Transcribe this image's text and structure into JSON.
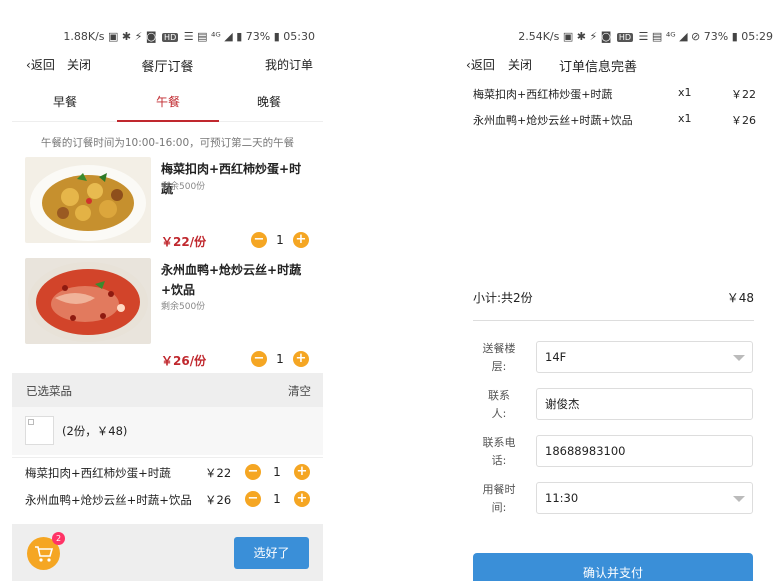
{
  "left": {
    "status": {
      "speed": "1.88K/s",
      "network": "⁴ᴳ",
      "battery": "73%",
      "time": "05:30"
    },
    "nav": {
      "back": "返回",
      "close": "关闭",
      "title": "餐厅订餐",
      "my_orders": "我的订单"
    },
    "tabs": [
      {
        "label": "早餐"
      },
      {
        "label": "午餐"
      },
      {
        "label": "晚餐"
      }
    ],
    "notice": "午餐的订餐时间为10:00-16:00，可预订第二天的午餐",
    "dishes": [
      {
        "name": "梅菜扣肉+西红柿炒蛋+时蔬",
        "remain": "剩余500份",
        "price": "￥22/份",
        "qty": "1"
      },
      {
        "name": "永州血鸭+炝炒云丝+时蔬+饮品",
        "remain": "剩余500份",
        "price": "￥26/份",
        "qty": "1"
      }
    ],
    "selected": {
      "header": "已选菜品",
      "clear": "清空",
      "summary": "(2份，￥48)",
      "items": [
        {
          "name": "梅菜扣肉+西红柿炒蛋+时蔬",
          "price": "￥22",
          "qty": "1"
        },
        {
          "name": "永州血鸭+炝炒云丝+时蔬+饮品",
          "price": "￥26",
          "qty": "1"
        }
      ]
    },
    "cart_badge": "2",
    "done_button": "选好了",
    "stepper": {
      "minus": "−",
      "plus": "+"
    }
  },
  "right": {
    "status": {
      "speed": "2.54K/s",
      "network": "⁴ᴳ",
      "battery": "73%",
      "time": "05:29"
    },
    "nav": {
      "back": "返回",
      "close": "关闭",
      "title": "订单信息完善"
    },
    "order_items": [
      {
        "name": "梅菜扣肉+西红柿炒蛋+时蔬",
        "qty": "x1",
        "price": "￥22"
      },
      {
        "name": "永州血鸭+炝炒云丝+时蔬+饮品",
        "qty": "x1",
        "price": "￥26"
      }
    ],
    "subtotal": {
      "label": "小计:共2份",
      "amount": "￥48"
    },
    "form": {
      "floor": {
        "label_line1": "送餐楼",
        "label_line2": "层:",
        "value": "14F"
      },
      "contact": {
        "label_line1": "联系",
        "label_line2": "人:",
        "value": "谢俊杰"
      },
      "phone": {
        "label_line1": "联系电",
        "label_line2": "话:",
        "value": "18688983100"
      },
      "meal_time": {
        "label_line1": "用餐时",
        "label_line2": "间:",
        "value": "11:30"
      }
    },
    "confirm_button": "确认并支付"
  },
  "colors": {
    "accent_red": "#c0282e",
    "accent_orange": "#f5a623",
    "primary_blue": "#3a8fd8"
  }
}
